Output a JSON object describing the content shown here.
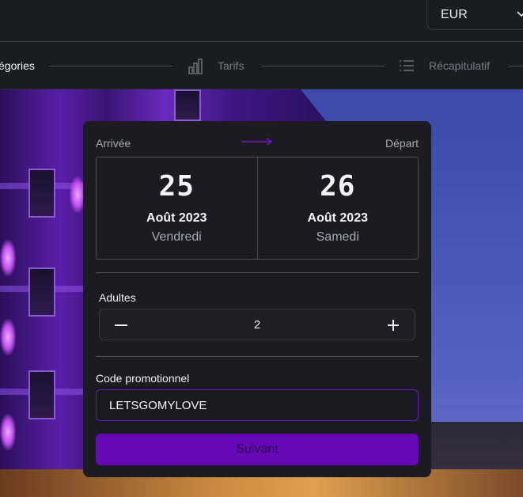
{
  "header": {
    "currency": "EUR"
  },
  "steps": [
    {
      "label": "égories"
    },
    {
      "label": "Tarifs"
    },
    {
      "label": "Récapitulatif"
    }
  ],
  "booking": {
    "arrival_label": "Arrivée",
    "departure_label": "Départ",
    "arrival": {
      "day": "25",
      "month": "Août 2023",
      "weekday": "Vendredi"
    },
    "departure": {
      "day": "26",
      "month": "Août 2023",
      "weekday": "Samedi"
    },
    "adults_label": "Adultes",
    "adults_value": "2",
    "promo_label": "Code promotionnel",
    "promo_value": "LETSGOMYLOVE",
    "next_label": "Suivant"
  },
  "colors": {
    "accent": "#6508b8",
    "card_bg": "#1c1b24",
    "bar_bg": "#1b1b23"
  }
}
